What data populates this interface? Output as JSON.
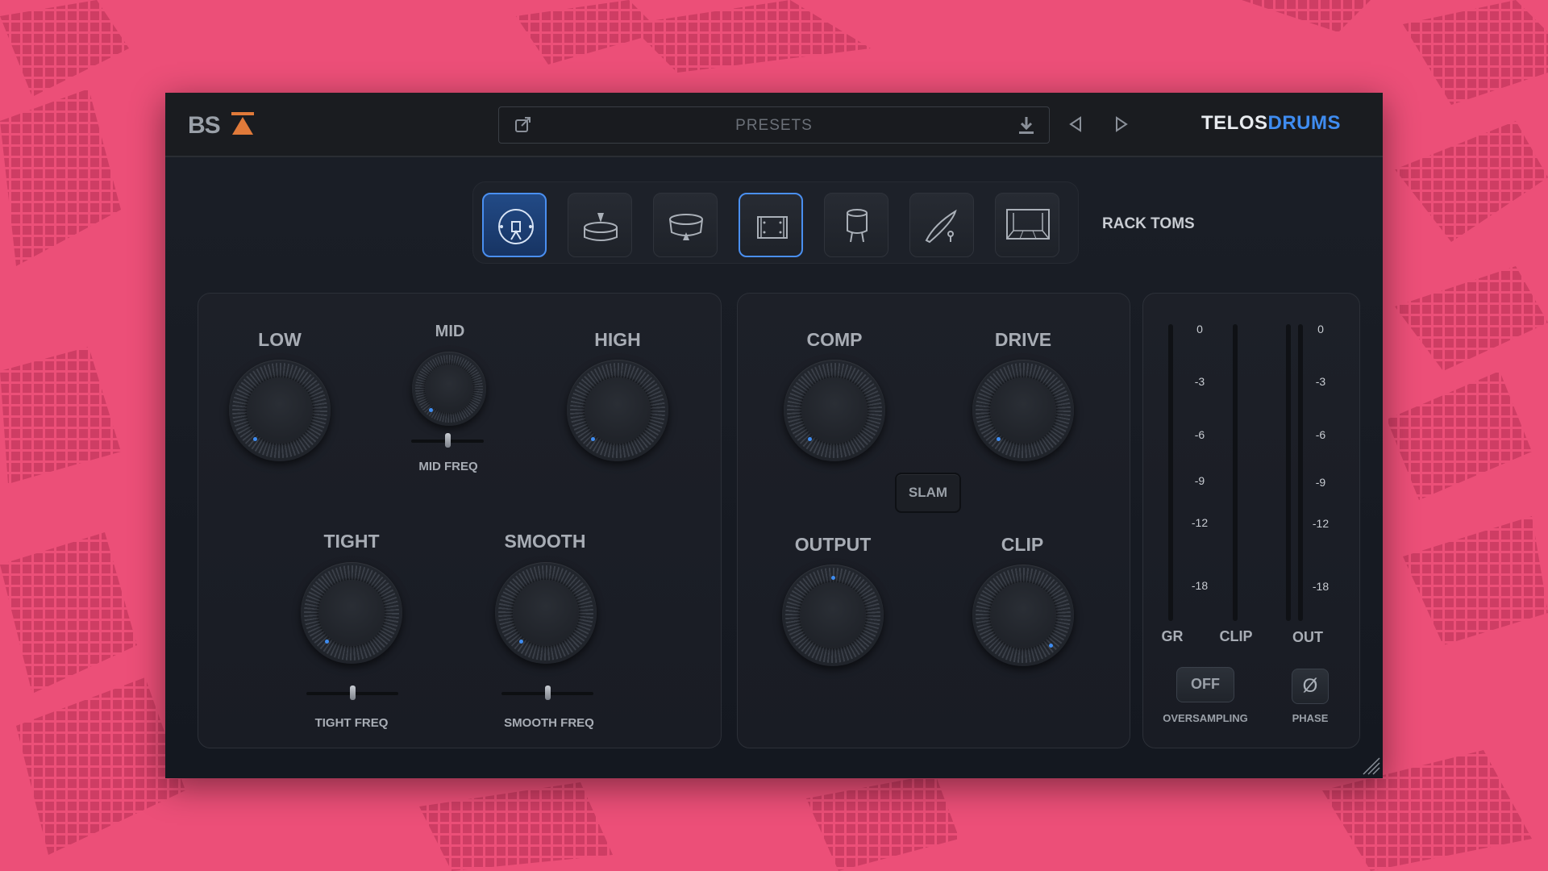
{
  "plugin": {
    "brand_logo": "BS",
    "brand_name_part1": "TELOS",
    "brand_name_part2": "DRUMS",
    "accent_color": "#3f8cf0"
  },
  "presets": {
    "label": "PRESETS"
  },
  "drum_selector": {
    "selected_label": "RACK TOMS",
    "buttons": [
      "kick",
      "snare",
      "rack-tom",
      "floor-tom",
      "snare-side",
      "cymbal",
      "room"
    ]
  },
  "eq_section": {
    "low": "LOW",
    "mid": "MID",
    "mid_freq": "MID FREQ",
    "high": "HIGH",
    "tight": "TIGHT",
    "tight_freq": "TIGHT FREQ",
    "smooth": "SMOOTH",
    "smooth_freq": "SMOOTH FREQ"
  },
  "dyn_section": {
    "comp": "COMP",
    "drive": "DRIVE",
    "slam": "SLAM",
    "output": "OUTPUT",
    "clip": "CLIP"
  },
  "meters": {
    "gr_ticks": [
      "0",
      "-3",
      "-6",
      "-9",
      "-12",
      "-18"
    ],
    "out_ticks": [
      "0",
      "-3",
      "-6",
      "-9",
      "-12",
      "-18"
    ],
    "gr": "GR",
    "clip": "CLIP",
    "out": "OUT",
    "oversampling_value": "OFF",
    "oversampling": "OVERSAMPLING",
    "phase": "PHASE",
    "phase_symbol": "Ø"
  }
}
